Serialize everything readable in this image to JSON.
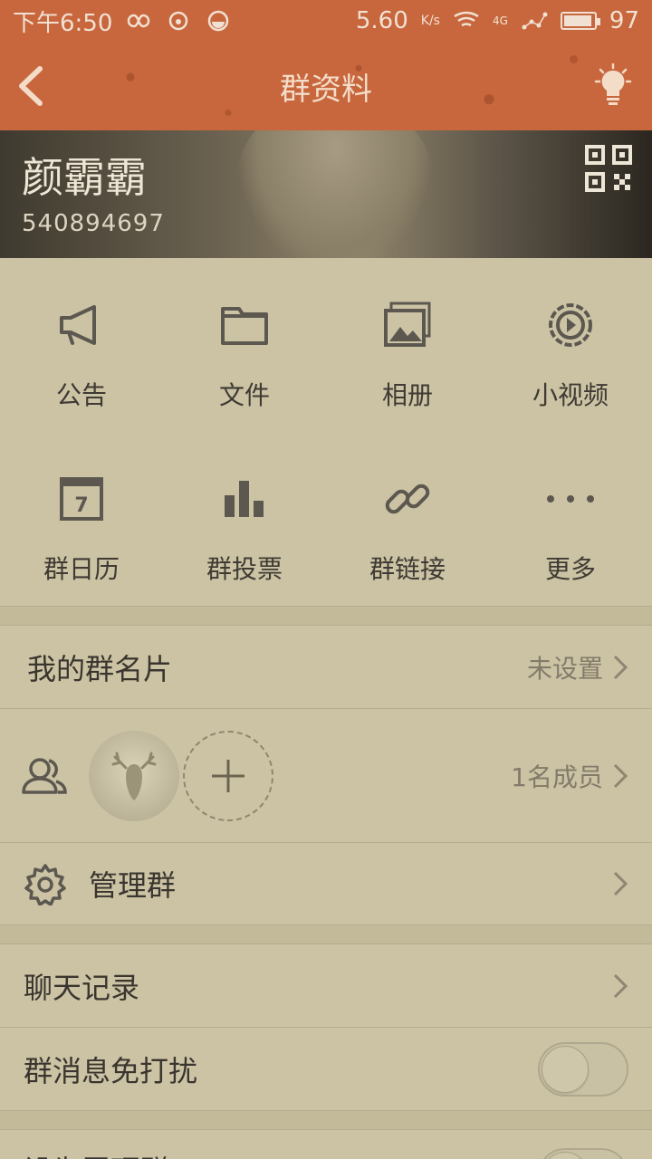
{
  "status_bar": {
    "time": "下午6:50",
    "speed": "5.60",
    "speed_unit": "K/s",
    "network": "4G",
    "battery": "97"
  },
  "nav": {
    "title": "群资料"
  },
  "group": {
    "name": "颜霸霸",
    "id": "540894697"
  },
  "grid": {
    "items": [
      {
        "label": "公告",
        "icon": "megaphone-icon"
      },
      {
        "label": "文件",
        "icon": "folder-icon"
      },
      {
        "label": "相册",
        "icon": "album-icon"
      },
      {
        "label": "小视频",
        "icon": "video-icon"
      },
      {
        "label": "群日历",
        "icon": "calendar-icon"
      },
      {
        "label": "群投票",
        "icon": "chart-icon"
      },
      {
        "label": "群链接",
        "icon": "link-icon"
      },
      {
        "label": "更多",
        "icon": "more-icon"
      }
    ],
    "calendar_day": "7"
  },
  "card": {
    "label": "我的群名片",
    "value": "未设置"
  },
  "members": {
    "count": "1名成员"
  },
  "manage": {
    "label": "管理群"
  },
  "history": {
    "label": "聊天记录"
  },
  "dnd": {
    "label": "群消息免打扰",
    "enabled": false
  },
  "pin": {
    "label": "设为置顶群",
    "enabled": false
  },
  "colors": {
    "accent": "#c8673d",
    "background": "#cbc3a4"
  }
}
